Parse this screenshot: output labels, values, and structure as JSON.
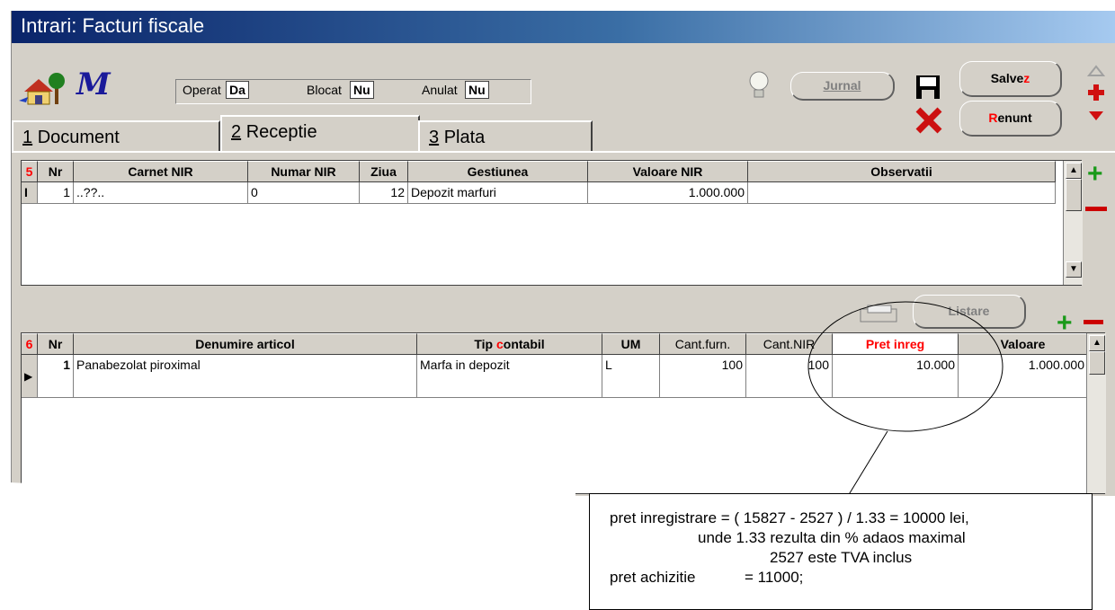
{
  "window": {
    "title": "Intrari: Facturi fiscale"
  },
  "toolbar": {
    "app_icon": "house-tree-icon",
    "m_logo": "M",
    "operat_label": "Operat",
    "operat_value": "Da",
    "blocat_label": "Blocat",
    "blocat_value": "Nu",
    "anulat_label": "Anulat",
    "anulat_value": "Nu",
    "jurnal_label": "Jurnal",
    "salvez_label": "Salvez",
    "renunt_label": "Renunt"
  },
  "tabs": [
    {
      "number": "1",
      "label": "Document"
    },
    {
      "number": "2",
      "label": "Receptie"
    },
    {
      "number": "3",
      "label": "Plata"
    }
  ],
  "grid_top": {
    "index": "5",
    "headers": [
      "Nr",
      "Carnet NIR",
      "Numar NIR",
      "Ziua",
      "Gestiunea",
      "Valoare NIR",
      "Observatii"
    ],
    "rows": [
      {
        "indicator": "I",
        "nr": "1",
        "carnet": "..??..",
        "numar": "0",
        "ziua": "12",
        "gestiunea": "Depozit marfuri",
        "valoare": "1.000.000",
        "observatii": ""
      }
    ]
  },
  "listare_label": "Listare",
  "grid_bottom": {
    "index": "6",
    "headers": [
      "Nr",
      "Denumire articol",
      "Tip contabil",
      "UM",
      "Cant.furn.",
      "Cant.NIR",
      "Pret inreg",
      "Valoare"
    ],
    "rows": [
      {
        "nr": "1",
        "denumire": "Panabezolat piroximal",
        "tip": "Marfa in depozit",
        "um": "L",
        "cant_furn": "100",
        "cant_nir": "100",
        "pret": "10.000",
        "valoare": "1.000.000"
      }
    ]
  },
  "note": {
    "line1": "pret inregistrare = ( 15827 - 2527 ) / 1.33 = 10000 lei,",
    "line2": "unde   1.33 rezulta din % adaos maximal",
    "line3": "2527 este TVA inclus",
    "line4_label": "pret achizitie",
    "line4_value": "= 11000;"
  },
  "colors": {
    "title_bar": "#0a246a",
    "accent_red": "#ff0000",
    "plus_green": "#1a9a1a",
    "window_bg": "#d4d0c8"
  }
}
